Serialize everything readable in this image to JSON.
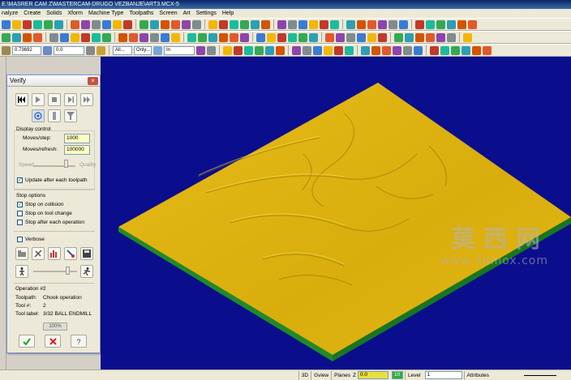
{
  "window": {
    "title": "E:\\MASRER CAM Z\\MASTERCAM-DRUGO VEZBANJE\\ART3.MCX-5"
  },
  "menu": [
    "nalyze",
    "Create",
    "Solids",
    "Xform",
    "Machine Type",
    "Toolpaths",
    "Screen",
    "Art",
    "Settings",
    "Help"
  ],
  "toolbar3": {
    "field1": "0.73692",
    "field2": "0.0",
    "field3": "All...",
    "field4": "Only...",
    "field5": "In"
  },
  "verify": {
    "title": "Verify",
    "close_label": "×",
    "display_control_label": "Display control",
    "moves_step_label": "Moves/step:",
    "moves_step_value": "1000",
    "moves_refresh_label": "Moves/refresh:",
    "moves_refresh_value": "100000",
    "speed_label": "Speed",
    "quality_label": "Quality",
    "update_label": "Update after each toolpath",
    "update_checked": true,
    "stop_options_label": "Stop options",
    "stop_collision_label": "Stop on collision",
    "stop_collision_checked": true,
    "stop_toolchange_label": "Stop on tool change",
    "stop_toolchange_checked": false,
    "stop_each_label": "Stop after each operation",
    "stop_each_checked": false,
    "verbose_label": "Verbose",
    "verbose_checked": false,
    "operation_label": "Operation #:",
    "operation_value": "2",
    "toolpath_label": "Toolpath:",
    "toolpath_value": "Chook operation",
    "tool_no_label": "Tool #:",
    "tool_no_value": "2",
    "tool_label_label": "Tool label:",
    "tool_label_value": "3/32 BALL ENDMILL",
    "progress_text": "100%",
    "progress_fraction": 1.0
  },
  "watermark": {
    "chinese": "莫西网",
    "url": "www.3dmox.com"
  },
  "status": {
    "mode_3d": "3D",
    "gview": "Gview",
    "planes": "Planes",
    "z_label": "Z",
    "z_value": "0.0",
    "color_value": "10",
    "level_label": "Level",
    "level_value": "1",
    "attributes": "Attributes"
  },
  "colors": {
    "viewport_bg": "#0b0e8c",
    "stock_top": "#e0b410",
    "stock_side": "#1f8a28"
  }
}
